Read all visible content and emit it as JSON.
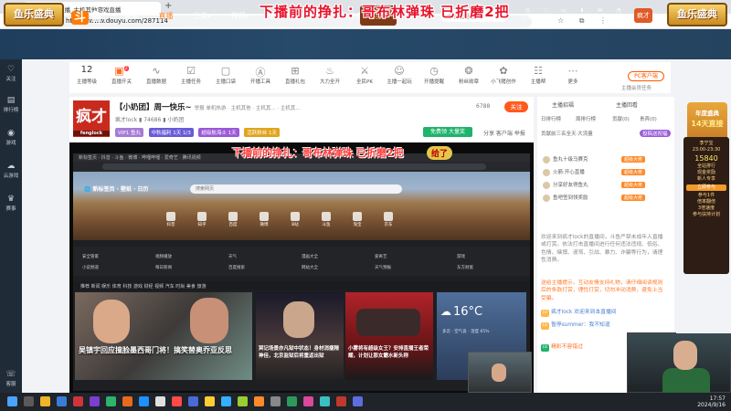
{
  "browser": {
    "tab_title": "疯才lock直播_主机其他游戏直播",
    "url": "https://www.douyu.com/287114",
    "new_tab": "+",
    "window_controls": "– □ ✕",
    "nav": "‹ › ⟳ ⌂",
    "tools": "☆ ⧉ ⋮"
  },
  "banner": "下播前的挣扎：哥布林弹珠 已折磨2把",
  "site": {
    "badge_left": "鱼乐盛典",
    "badge_right": "鱼乐盛典",
    "logo_mark": "斗",
    "logo_text": "鱼",
    "nav": [
      "首页",
      "直播",
      "分类▾",
      "视频▾",
      "游戏▾",
      "鱼吧",
      "鱼乐盛典"
    ],
    "event": "超级中秋季 2024",
    "search_placeholder": "中秋理想国",
    "search_icon": "search-icon",
    "header_icons": [
      "历史",
      "关注",
      "开播",
      "客户端",
      "私信",
      "消息"
    ],
    "avatar": "疯才"
  },
  "sidebar": [
    "关注",
    "排行榜",
    "游戏",
    "云游戏",
    "赛事",
    "客服"
  ],
  "toolbar": {
    "level": "12",
    "items": [
      "主播等级",
      "直播开关",
      "直播数据",
      "主播任务",
      "主播口袋",
      "开播工具",
      "直播礼包",
      "主播奖励",
      "大力全开",
      "全民PK",
      "主播一起玩",
      "开播提醒",
      "粉丝勋章",
      "水下游泳",
      "小飞猪创作",
      "主播帮",
      "更多"
    ],
    "pc_button": "PC客户端",
    "vip_note": "主播会员任务",
    "notify_count": "2"
  },
  "room": {
    "avatar_text": "疯才",
    "avatar_sub": "fenglock",
    "title": "【小奶团】周一快乐~",
    "title_extra": "举报 单机热游 · 主机其他 · 主机其... · 主机其...",
    "sub": "疯才lock  ▮ 74686  ▮ 小奶团",
    "badges": [
      "VIP1 鱼丸",
      "中秋福利 1天 1/3",
      "超级航海士 1天",
      "活跃粉丝 1天"
    ],
    "follow": "关注",
    "follow_count": "6788",
    "free_gift": "免费领 大量奖",
    "share": "分享  客户端  举报"
  },
  "player": {
    "overlay_title": "下播前的挣扎：哥布林弹珠 已折磨2把",
    "overlay_label": "给了",
    "inner_tabs": "新标签页 · 抖音 · 斗鱼 · 微博 · 哔哩哔哩 · 爱奇艺 · 腾讯视频",
    "inner_logo": "🌐 新标签页 · 壁纸 · 日历",
    "inner_search": "搜索网页",
    "shortcuts": [
      "抖音",
      "知乎",
      "百度",
      "微博",
      "B站",
      "斗鱼",
      "淘宝",
      "京东"
    ],
    "quicklinks": [
      "安全管家",
      "视频播放",
      "天气",
      "漫画大全",
      "爱奇艺",
      "游戏",
      "小说频道",
      "每日新闻",
      "百度搜索",
      "网站大全",
      "天气预报",
      "东方财富"
    ],
    "news_tabs": "推荐  新闻  娱乐  体育  科技  游戏  财经  视频  汽车  时尚  美食  旅游",
    "card1_caption": "吴镇宇回应撞脸墨西哥门将！搞笑替奥乔亚反思",
    "card2_caption": "冥记场景亦凡狱中状态！身材消瘦精神佳，北京监狱后将重返出狱",
    "card3_caption": "小雾将有超级女王？安排直播王者荣耀，计划让那女霸水新头称",
    "weather_temp": "16°C",
    "weather_detail": "多云 · 空气良 · 湿度 65%"
  },
  "rightpanel": {
    "tabs": [
      "主播招福",
      "主播回看"
    ],
    "rank_tabs": [
      "日排行榜",
      "周排行榜",
      "贡献(0)",
      "贵宾(0)"
    ],
    "rank_note": "贡献前三名全天·大流量",
    "intro": "投稿送祝福",
    "rows": [
      {
        "name": "鱼丸十级马赛克",
        "tag": "超级大佬"
      },
      {
        "name": "火箭·开心直播",
        "tag": "超级大佬"
      },
      {
        "name": "分享好友得鱼丸",
        "tag": "超级大佬"
      },
      {
        "name": "鱼吧签到领奖励",
        "tag": "超级大佬"
      }
    ],
    "chat": [
      "欢迎来到疯才lock的直播间，斗鱼严禁未成年人直播或打赏。依法打击直播间进行任何违法违规、低俗、色情、赌博、谩骂、引战、暴力、诈骗等行为，请理性消费。",
      "送给主播提示，互动友情支持礼物，请仔细阅读规则后的条款打赏，理性打赏，切勿冲动消费，避免上当受骗。",
      "疯才lock  欢迎来到本直播间",
      "暂停summer：我不知道",
      "精彩不容错过",
      "暂停summer：能我都在"
    ]
  },
  "ads": {
    "ad1_title": "年度盛典",
    "ad1_sub": "14天直接",
    "panel": [
      "李宁宝",
      "23:00-23:30",
      "15840",
      "全站排行",
      "现金奖励",
      "新人专享",
      "参与1件",
      "倍率翻倍",
      "3倍速度",
      "参与扶持计划"
    ],
    "panel_btn": "立即参与"
  },
  "taskbar": {
    "time": "17:57",
    "date": "2024/9/16"
  },
  "colors": {
    "accent": "#ff5a1e",
    "header": "#24435f",
    "sidebar": "#202b38"
  }
}
